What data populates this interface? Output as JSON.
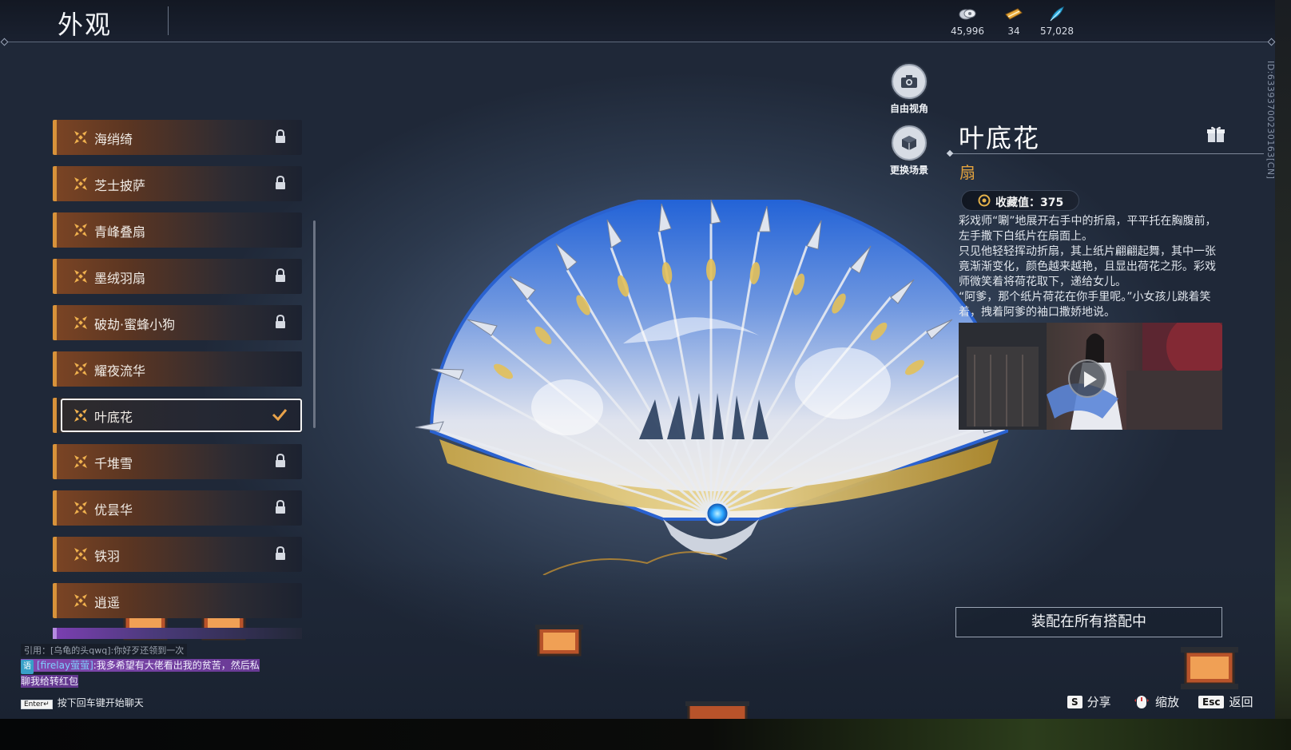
{
  "header": {
    "title": "外观",
    "currencies": [
      {
        "icon": "coin-stack-icon",
        "value": "45,996"
      },
      {
        "icon": "ticket-icon",
        "value": "34"
      },
      {
        "icon": "feather-icon",
        "value": "57,028"
      }
    ]
  },
  "id_text": "ID:6339370023016​3[CN]",
  "camera": {
    "free_view_label": "自由视角",
    "change_scene_label": "更换场景"
  },
  "list": {
    "items": [
      {
        "label": "海绡绮",
        "locked": true
      },
      {
        "label": "芝士披萨",
        "locked": true
      },
      {
        "label": "青峰叠扇",
        "locked": false
      },
      {
        "label": "墨绒羽扇",
        "locked": true
      },
      {
        "label": "破劫·蜜蜂小狗",
        "locked": true
      },
      {
        "label": "耀夜流华",
        "locked": false
      },
      {
        "label": "叶底花",
        "locked": false,
        "selected": true
      },
      {
        "label": "千堆雪",
        "locked": true
      },
      {
        "label": "优昙华",
        "locked": true
      },
      {
        "label": "铁羽",
        "locked": true
      },
      {
        "label": "逍遥",
        "locked": false
      }
    ]
  },
  "detail": {
    "name": "叶底花",
    "type": "扇",
    "collect_label": "收藏值：375",
    "description": "彩戏师“唰”地展开右手中的折扇，平平托在胸腹前，左手撒下白纸片在扇面上。\n只见他轻轻挥动折扇，其上纸片翩翩起舞，其中一张竟渐渐变化，颜色越来越艳，且显出荷花之形。彩戏师微笑着将荷花取下，递给女儿。\n“阿爹，那个纸片荷花在你手里呢。”小女孩儿跳着笑着，拽着阿爹的袖口撒娇地说。",
    "equip_all_label": "装配在所有搭配中"
  },
  "chat": {
    "quote": "引用：[乌龟的头qwq]:你好歹还领到一次",
    "tag": "语",
    "sender": "[firelay萤萤]",
    "message": ":我多希望有大佬看出我的贫苦，然后私聊我给转红包",
    "input_key": "Enter↵",
    "input_hint": "按下回车键开始聊天"
  },
  "hints": [
    {
      "key": "S",
      "label": "分享"
    },
    {
      "key": "",
      "label": "缩放",
      "icon": "mouse-icon"
    },
    {
      "key": "Esc",
      "label": "返回"
    }
  ],
  "colors": {
    "accent_orange": "#d8923a",
    "type_gold": "#e3a23e",
    "fan_blue": "#2f6fd8"
  }
}
